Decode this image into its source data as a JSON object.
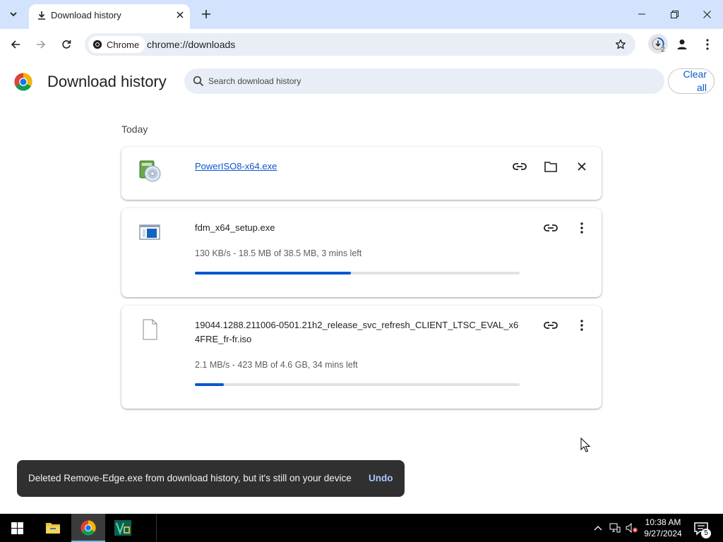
{
  "browser": {
    "tab": {
      "title": "Download history",
      "icon": "download-icon"
    },
    "chip_label": "Chrome",
    "url": "chrome://downloads",
    "downloads_badge": "2"
  },
  "page": {
    "title": "Download history",
    "search_placeholder": "Search download history",
    "clear_all_label": "Clear all",
    "date_group": "Today"
  },
  "downloads": [
    {
      "name": "PowerISO8-x64.exe",
      "icon": "poweriso-disc-icon",
      "state": "complete"
    },
    {
      "name": "fdm_x64_setup.exe",
      "icon": "setup-window-icon",
      "status": "130 KB/s - 18.5 MB of 38.5 MB, 3 mins left",
      "progress": 0.48
    },
    {
      "name": "19044.1288.211006-0501.21h2_release_svc_refresh_CLIENT_LTSC_EVAL_x64FRE_fr-fr.iso",
      "icon": "blank-file-icon",
      "status": "2.1 MB/s - 423 MB of 4.6 GB, 34 mins left",
      "progress": 0.09
    }
  ],
  "toast": {
    "message": "Deleted Remove-Edge.exe from download history, but it's still on your device",
    "action": "Undo"
  },
  "taskbar": {
    "time": "10:38 AM",
    "date": "9/27/2024",
    "notification_count": "5"
  },
  "colors": {
    "accent": "#0b57d0",
    "tabstrip": "#d3e3fd",
    "toast_bg": "#303030",
    "progress_track": "#e1e3e1"
  }
}
